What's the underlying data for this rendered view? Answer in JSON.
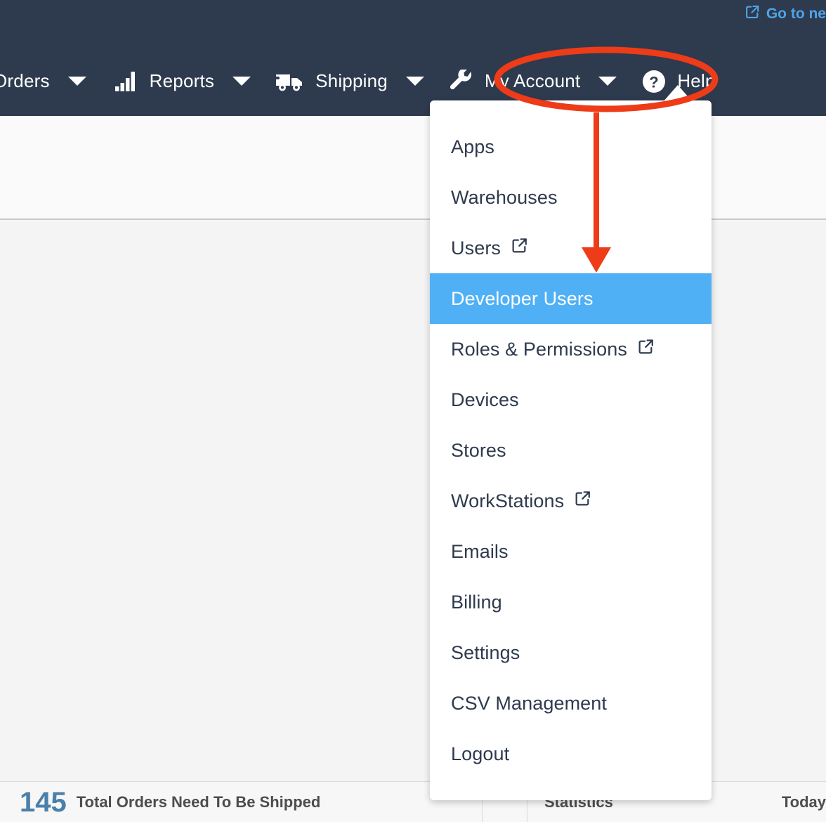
{
  "utility_bar": {
    "go_to_new_link": "Go to ne",
    "go_to_new_icon": "external-link-icon"
  },
  "main_nav": {
    "items": [
      {
        "label": "Orders",
        "icon": "none",
        "has_caret": true
      },
      {
        "label": "Reports",
        "icon": "bar-chart-icon",
        "has_caret": true
      },
      {
        "label": "Shipping",
        "icon": "truck-icon",
        "has_caret": true
      },
      {
        "label": "My Account",
        "icon": "wrench-icon",
        "has_caret": true
      },
      {
        "label": "Help",
        "icon": "question-circle-icon",
        "has_caret": false
      }
    ]
  },
  "account_dropdown": {
    "open": true,
    "items": [
      {
        "label": "Apps",
        "external": false,
        "active": false
      },
      {
        "label": "Warehouses",
        "external": false,
        "active": false
      },
      {
        "label": "Users",
        "external": true,
        "active": false
      },
      {
        "label": "Developer Users",
        "external": false,
        "active": true
      },
      {
        "label": "Roles & Permissions",
        "external": true,
        "active": false
      },
      {
        "label": "Devices",
        "external": false,
        "active": false
      },
      {
        "label": "Stores",
        "external": false,
        "active": false
      },
      {
        "label": "WorkStations",
        "external": true,
        "active": false
      },
      {
        "label": "Emails",
        "external": false,
        "active": false
      },
      {
        "label": "Billing",
        "external": false,
        "active": false
      },
      {
        "label": "Settings",
        "external": false,
        "active": false
      },
      {
        "label": "CSV Management",
        "external": false,
        "active": false
      },
      {
        "label": "Logout",
        "external": false,
        "active": false
      }
    ]
  },
  "annotations": {
    "highlight_ellipse_target": "My Account",
    "arrow_target": "Developer Users",
    "color": "#ee3b18"
  },
  "footer": {
    "orders_count": "145",
    "orders_label": "Total Orders Need To Be Shipped",
    "statistics_label": "Statistics",
    "today_label": "Today"
  },
  "colors": {
    "nav_background": "#2e3a4e",
    "menu_highlight": "#4fb0f5",
    "link_blue": "#4fa3e8",
    "annotation_red": "#ee3b18",
    "footer_count_blue": "#4a80aa"
  }
}
